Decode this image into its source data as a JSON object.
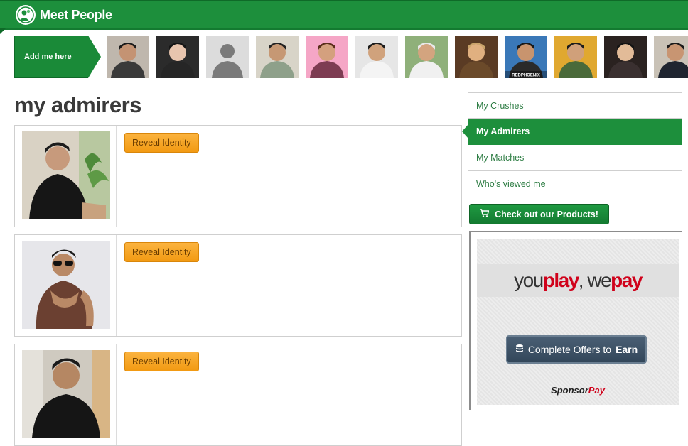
{
  "header": {
    "title": "Meet People",
    "logo_icon": "people-globe-icon",
    "brand_color": "#1d8f3c"
  },
  "people_strip": {
    "add_label": "Add me here",
    "thumbnails": [
      {
        "name": "member-1",
        "placeholder": false
      },
      {
        "name": "member-2",
        "placeholder": false
      },
      {
        "name": "member-3",
        "placeholder": true
      },
      {
        "name": "member-4",
        "placeholder": false
      },
      {
        "name": "member-5",
        "placeholder": false
      },
      {
        "name": "member-6",
        "placeholder": false
      },
      {
        "name": "member-7",
        "placeholder": false
      },
      {
        "name": "member-8",
        "placeholder": false
      },
      {
        "name": "member-9",
        "placeholder": false,
        "caption": "REDPHOENIX"
      },
      {
        "name": "member-10",
        "placeholder": false
      },
      {
        "name": "member-11",
        "placeholder": false
      },
      {
        "name": "member-12",
        "placeholder": false
      }
    ]
  },
  "main": {
    "title": "my admirers",
    "admirers": [
      {
        "reveal_label": "Reveal Identity"
      },
      {
        "reveal_label": "Reveal Identity"
      },
      {
        "reveal_label": "Reveal Identity"
      }
    ]
  },
  "sidebar": {
    "nav": [
      {
        "label": "My Crushes",
        "active": false
      },
      {
        "label": "My Admirers",
        "active": true
      },
      {
        "label": "My Matches",
        "active": false
      },
      {
        "label": "Who's viewed me",
        "active": false
      }
    ],
    "products_button": {
      "label": "Check out our Products!",
      "icon": "cart-icon"
    }
  },
  "ad": {
    "headline_you": "you",
    "headline_play": "play",
    "headline_comma": ", ",
    "headline_we": "we",
    "headline_pay": "pay",
    "offer_prefix": "Complete Offers to",
    "offer_bold": "Earn",
    "offer_icon": "coins-stack-icon",
    "sponsor_prefix": "Sponsor",
    "sponsor_suffix": "Pay"
  }
}
